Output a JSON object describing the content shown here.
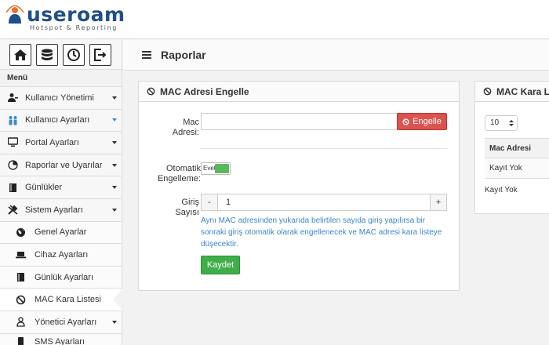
{
  "brand": {
    "name": "useroam",
    "tagline": "Hotspot & Reporting",
    "color": "#1f4f86"
  },
  "quick_actions": [
    {
      "icon": "home-icon"
    },
    {
      "icon": "database-icon"
    },
    {
      "icon": "clock-icon"
    },
    {
      "icon": "logout-icon"
    }
  ],
  "sidebar": {
    "title": "Menü",
    "items": [
      {
        "label": "Kullanıcı Yönetimi",
        "icon": "user-admin-icon"
      },
      {
        "label": "Kullanıcı Ayarları",
        "icon": "users-icon"
      },
      {
        "label": "Portal Ayarları",
        "icon": "monitor-icon"
      },
      {
        "label": "Raporlar ve Uyarılar",
        "icon": "pie-chart-icon"
      },
      {
        "label": "Günlükler",
        "icon": "book-icon"
      },
      {
        "label": "Sistem Ayarları",
        "icon": "tools-icon"
      }
    ],
    "subitems": [
      {
        "label": "Genel Ayarlar",
        "icon": "globe-icon"
      },
      {
        "label": "Cihaz Ayarları",
        "icon": "laptop-icon"
      },
      {
        "label": "Günlük Ayarları",
        "icon": "notebook-icon"
      },
      {
        "label": "MAC Kara Listesi",
        "icon": "ban-icon"
      },
      {
        "label": "Yönetici Ayarları",
        "icon": "admin-icon"
      },
      {
        "label": "SMS Ayarları",
        "icon": "sms-icon"
      }
    ]
  },
  "page": {
    "title": "Raporlar"
  },
  "block_panel": {
    "title": "MAC Adresi Engelle",
    "mac_label_line1": "Mac",
    "mac_label_line2": "Adresi:",
    "mac_value": "",
    "block_button": "Engelle",
    "auto_label_line1": "Otomatik",
    "auto_label_line2": "Engelleme:",
    "toggle_text": "Evet",
    "toggle_on": true,
    "attempts_label_line1": "Giriş",
    "attempts_label_line2": "Sayısı",
    "minus": "-",
    "plus": "+",
    "attempts_value": "1",
    "help_line1": "Aynı MAC adresinden yukarıda belirtilen sayıda giriş yapılırsa bir",
    "help_line2": "sonraki giriş otomatik olarak engellenecek ve MAC adresi kara listeye",
    "help_line3": "düşecektir.",
    "save_button": "Kaydet"
  },
  "blacklist_panel": {
    "title": "MAC Kara L",
    "page_size": "10",
    "column": "Mac Adresi",
    "empty_row": "Kayıt Yok",
    "footer": "Kayıt Yok"
  },
  "colors": {
    "danger": "#d9534f",
    "success": "#3fae49",
    "info_text": "#3a87c8"
  }
}
